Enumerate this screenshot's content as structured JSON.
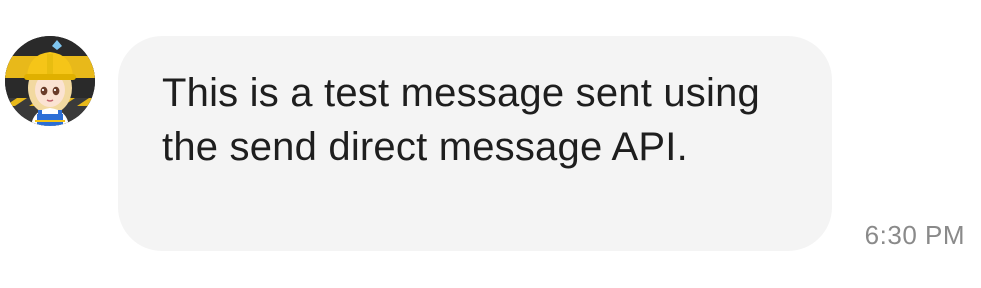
{
  "message": {
    "text": "This is a test message sent using the send direct message API.",
    "timestamp": "6:30 PM"
  },
  "avatar": {
    "icon": "user-avatar-icon",
    "colors": {
      "background": "#1f1f1f",
      "helmet": "#f5c518",
      "hair": "#f2d9a0"
    }
  },
  "colors": {
    "bubble": "#f4f4f4",
    "text": "#1e1e1e",
    "timestamp": "#8a8a8a"
  }
}
